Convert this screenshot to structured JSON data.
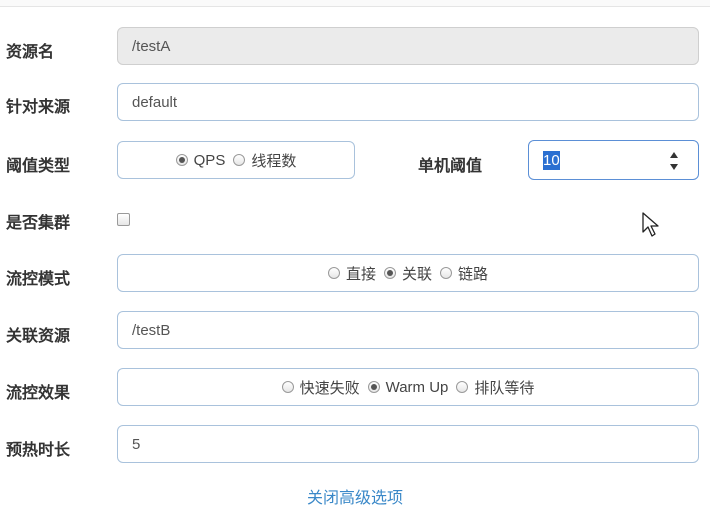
{
  "form": {
    "resource_name": {
      "label": "资源名",
      "value": "/testA"
    },
    "limit_app": {
      "label": "针对来源",
      "value": "default"
    },
    "grade": {
      "label": "阈值类型",
      "options": [
        {
          "label": "QPS",
          "checked": true
        },
        {
          "label": "线程数",
          "checked": false
        }
      ]
    },
    "count": {
      "label": "单机阈值",
      "value": "10"
    },
    "cluster": {
      "label": "是否集群",
      "checked": false
    },
    "strategy": {
      "label": "流控模式",
      "options": [
        {
          "label": "直接",
          "checked": false
        },
        {
          "label": "关联",
          "checked": true
        },
        {
          "label": "链路",
          "checked": false
        }
      ]
    },
    "ref_resource": {
      "label": "关联资源",
      "value": "/testB"
    },
    "control_behavior": {
      "label": "流控效果",
      "options": [
        {
          "label": "快速失败",
          "checked": false
        },
        {
          "label": "Warm Up",
          "checked": true
        },
        {
          "label": "排队等待",
          "checked": false
        }
      ]
    },
    "warmup_period": {
      "label": "预热时长",
      "value": "5"
    },
    "advanced_toggle": "关闭高级选项"
  },
  "colors": {
    "border": "#a9c2dc",
    "readonly_bg": "#ebebeb",
    "link": "#3a88c8",
    "selection": "#2a6fd1"
  }
}
